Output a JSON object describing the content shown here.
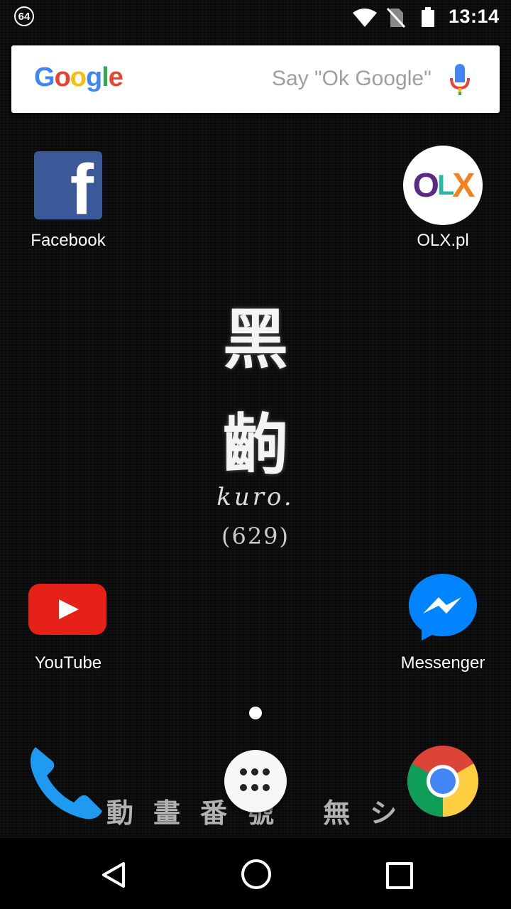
{
  "status_bar": {
    "notification_count": "64",
    "time": "13:14",
    "icons": [
      "wifi-icon",
      "no-sim-icon",
      "battery-icon"
    ]
  },
  "search": {
    "logo": "Google",
    "hint": "Say \"Ok Google\"",
    "mic_icon": "mic-icon"
  },
  "apps": [
    {
      "label": "Facebook",
      "icon": "facebook-icon"
    },
    {
      "label": "OLX.pl",
      "icon": "olx-icon"
    },
    {
      "label": "YouTube",
      "icon": "youtube-icon"
    },
    {
      "label": "Messenger",
      "icon": "messenger-icon"
    }
  ],
  "widget": {
    "kanji_top": "黑",
    "kanji_bottom": "齣",
    "romaji": "kuro.",
    "number": "(629)"
  },
  "dock": {
    "bottom_text": "動畫番號 無シ",
    "items": [
      "phone-icon",
      "app-drawer-icon",
      "chrome-icon"
    ]
  },
  "nav": [
    "back-icon",
    "home-icon",
    "recents-icon"
  ],
  "colors": {
    "facebook": "#3b5998",
    "youtube": "#e62117",
    "messenger": "#0084ff"
  }
}
